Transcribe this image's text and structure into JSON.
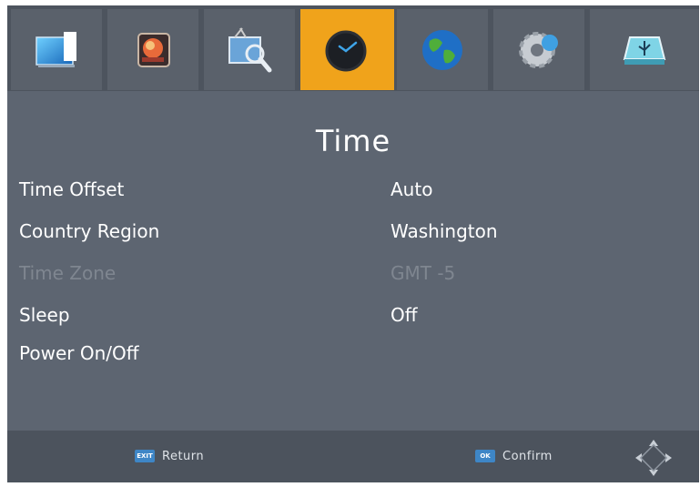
{
  "menu": {
    "tabs": [
      {
        "icon": "display-icon"
      },
      {
        "icon": "picture-icon"
      },
      {
        "icon": "channel-search-icon"
      },
      {
        "icon": "clock-icon",
        "active": true
      },
      {
        "icon": "globe-icon"
      },
      {
        "icon": "settings-gear-icon"
      },
      {
        "icon": "usb-icon"
      }
    ]
  },
  "page": {
    "title": "Time",
    "rows": [
      {
        "label": "Time Offset",
        "value": "Auto"
      },
      {
        "label": "Country Region",
        "value": "Washington"
      },
      {
        "label": "Time Zone",
        "value": "GMT -5",
        "disabled": true
      },
      {
        "label": "Sleep",
        "value": "Off"
      },
      {
        "label": "Power On/Off",
        "value": ""
      }
    ]
  },
  "footer": {
    "return_key": "EXIT",
    "return_label": "Return",
    "confirm_key": "OK",
    "confirm_label": "Confirm"
  },
  "colors": {
    "background": "#5d6571",
    "active_tab": "#f0a31b",
    "disabled_text": "#7f8690"
  }
}
